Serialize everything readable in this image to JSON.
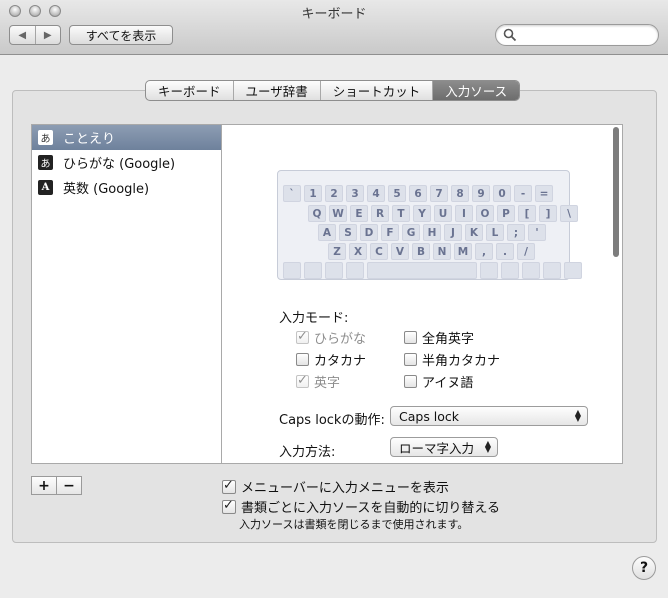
{
  "window": {
    "title": "キーボード"
  },
  "toolbar": {
    "back": "◀",
    "forward": "▶",
    "show_all": "すべてを表示",
    "search_placeholder": ""
  },
  "tabs": [
    {
      "label": "キーボード",
      "active": false
    },
    {
      "label": "ユーザ辞書",
      "active": false
    },
    {
      "label": "ショートカット",
      "active": false
    },
    {
      "label": "入力ソース",
      "active": true
    }
  ],
  "sources": [
    {
      "icon": "あ",
      "label": "ことえり",
      "selected": true
    },
    {
      "icon": "あ",
      "label": "ひらがな (Google)",
      "selected": false
    },
    {
      "icon": "A",
      "label": "英数 (Google)",
      "selected": false
    }
  ],
  "keyboard": {
    "rows": [
      [
        "`",
        "1",
        "2",
        "3",
        "4",
        "5",
        "6",
        "7",
        "8",
        "9",
        "0",
        "-",
        "="
      ],
      [
        "Q",
        "W",
        "E",
        "R",
        "T",
        "Y",
        "U",
        "I",
        "O",
        "P",
        "[",
        "]",
        "\\"
      ],
      [
        "A",
        "S",
        "D",
        "F",
        "G",
        "H",
        "J",
        "K",
        "L",
        ";",
        "'"
      ],
      [
        "Z",
        "X",
        "C",
        "V",
        "B",
        "N",
        "M",
        ",",
        ".",
        "/"
      ]
    ]
  },
  "input_mode": {
    "label": "入力モード:",
    "options": {
      "hiragana": {
        "label": "ひらがな",
        "checked": true,
        "enabled": false
      },
      "zenkaku_eiji": {
        "label": "全角英字",
        "checked": false,
        "enabled": true
      },
      "katakana": {
        "label": "カタカナ",
        "checked": false,
        "enabled": true
      },
      "hankaku_katakana": {
        "label": "半角カタカナ",
        "checked": false,
        "enabled": true
      },
      "eiji": {
        "label": "英字",
        "checked": true,
        "enabled": false
      },
      "ainu": {
        "label": "アイヌ語",
        "checked": false,
        "enabled": true
      }
    }
  },
  "caps_lock": {
    "label": "Caps lockの動作:",
    "value": "Caps lock"
  },
  "input_method": {
    "label": "入力方法:",
    "value": "ローマ字入力"
  },
  "list_buttons": {
    "add": "+",
    "remove": "−"
  },
  "options": {
    "show_menu": {
      "label": "メニューバーに入力メニューを表示",
      "checked": true
    },
    "auto_switch": {
      "label": "書類ごとに入力ソースを自動的に切り替える",
      "checked": true
    },
    "note": "入力ソースは書類を閉じるまで使用されます。"
  },
  "help": "?"
}
